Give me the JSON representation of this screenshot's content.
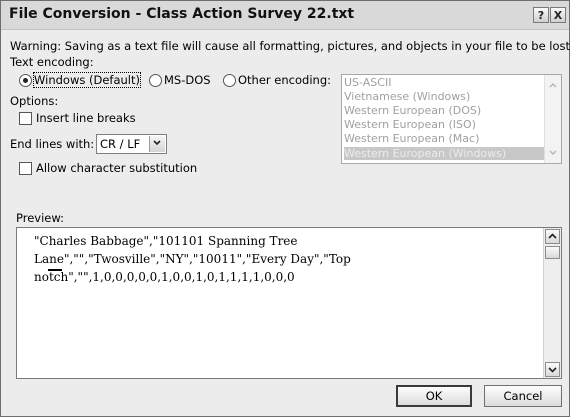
{
  "window": {
    "title": "File Conversion - Class Action Survey 22.txt",
    "help_label": "?",
    "close_label": "X"
  },
  "warning": "Warning: Saving as a text file will cause all formatting, pictures, and objects in your file to be lost.",
  "text_encoding": {
    "label": "Text encoding:",
    "options": [
      {
        "label": "Windows (Default)",
        "selected": true
      },
      {
        "label": "MS-DOS",
        "selected": false
      },
      {
        "label": "Other encoding:",
        "selected": false
      }
    ],
    "list": [
      {
        "label": "US-ASCII",
        "selected": false
      },
      {
        "label": "Vietnamese (Windows)",
        "selected": false
      },
      {
        "label": "Western European (DOS)",
        "selected": false
      },
      {
        "label": "Western European (ISO)",
        "selected": false
      },
      {
        "label": "Western European (Mac)",
        "selected": false
      },
      {
        "label": "Western European (Windows)",
        "selected": true
      }
    ]
  },
  "options": {
    "label": "Options:",
    "insert_line_breaks": {
      "label": "Insert line breaks",
      "checked": false
    },
    "end_lines_with": {
      "label": "End lines with:",
      "value": "CR / LF"
    },
    "allow_char_subst": {
      "label": "Allow character substitution",
      "checked": false
    }
  },
  "preview": {
    "label": "Preview:",
    "text": "\"Charles Babbage\",\"101101 Spanning Tree Lane\",\"\",\"Twosville\",\"NY\",\"10011\",\"Every Day\",\"Top notch\",\"\",1,0,0,0,0,0,1,0,0,1,0,1,1,1,1,0,0,0"
  },
  "buttons": {
    "ok": "OK",
    "cancel": "Cancel"
  },
  "icons": [
    "help-icon",
    "close-icon",
    "chevron-down-icon",
    "chevron-up-icon",
    "scroll-up-icon",
    "scroll-down-icon"
  ],
  "colors": {
    "dialog_bg": "#ececec",
    "list_selected_bg": "#c8c8c8",
    "disabled_text": "#a0a0a0"
  }
}
